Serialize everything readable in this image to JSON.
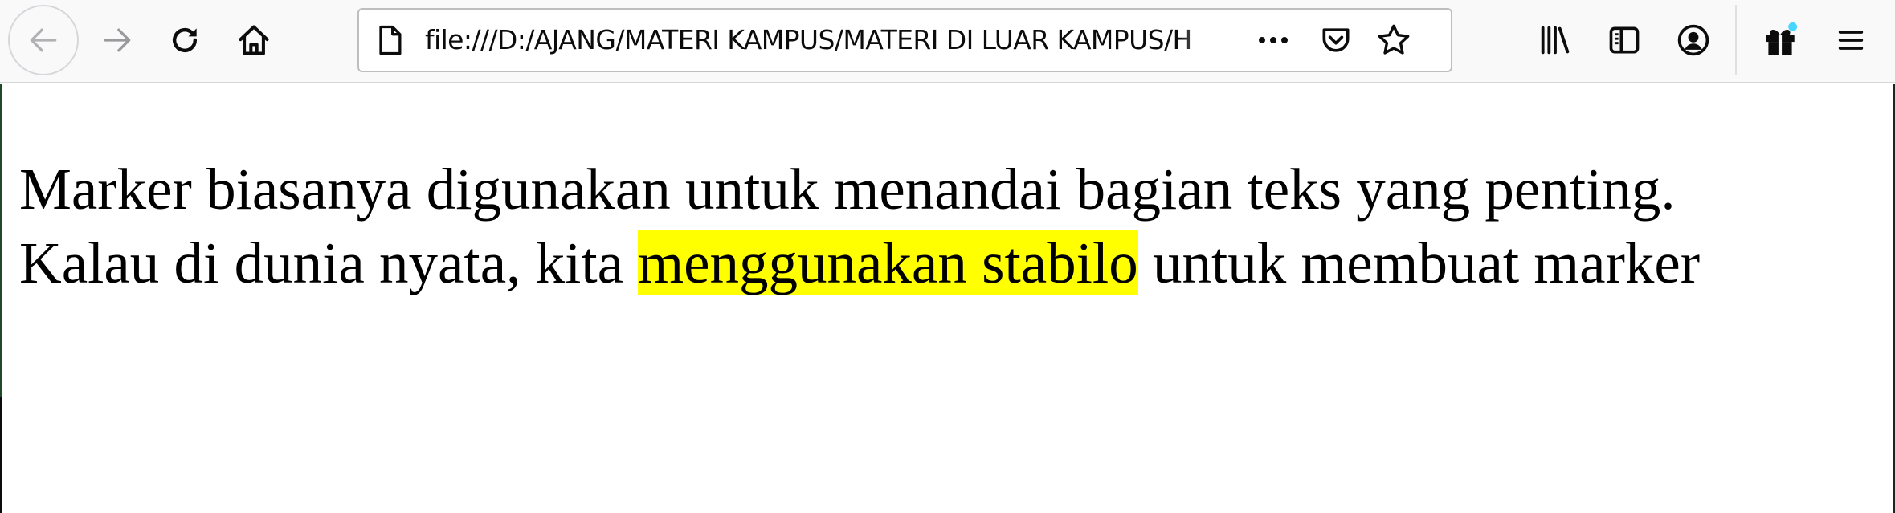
{
  "browser": {
    "url": "file:///D:/AJANG/MATERI KAMPUS/MATERI DI LUAR KAMPUS/H",
    "toolbar_icons": {
      "back": "back-arrow-icon",
      "forward": "forward-arrow-icon",
      "reload": "reload-icon",
      "home": "home-icon",
      "page_info": "page-icon",
      "page_actions": "more-dots-icon",
      "pocket": "pocket-icon",
      "bookmark": "star-icon",
      "library": "library-icon",
      "sidebar": "sidebar-icon",
      "account": "account-icon",
      "whats_new": "gift-icon",
      "menu": "hamburger-menu-icon"
    },
    "colors": {
      "toolbar_bg": "#f9f9fa",
      "icon": "#0c0c0d",
      "gift_dot": "#45d7ff"
    }
  },
  "page": {
    "line1": "Marker biasanya digunakan untuk menandai bagian teks yang penting.",
    "line2_before": "Kalau di dunia nyata, kita ",
    "line2_marked": "menggunakan stabilo",
    "line2_after": " untuk membuat marker",
    "highlight_color": "#ffff00"
  }
}
